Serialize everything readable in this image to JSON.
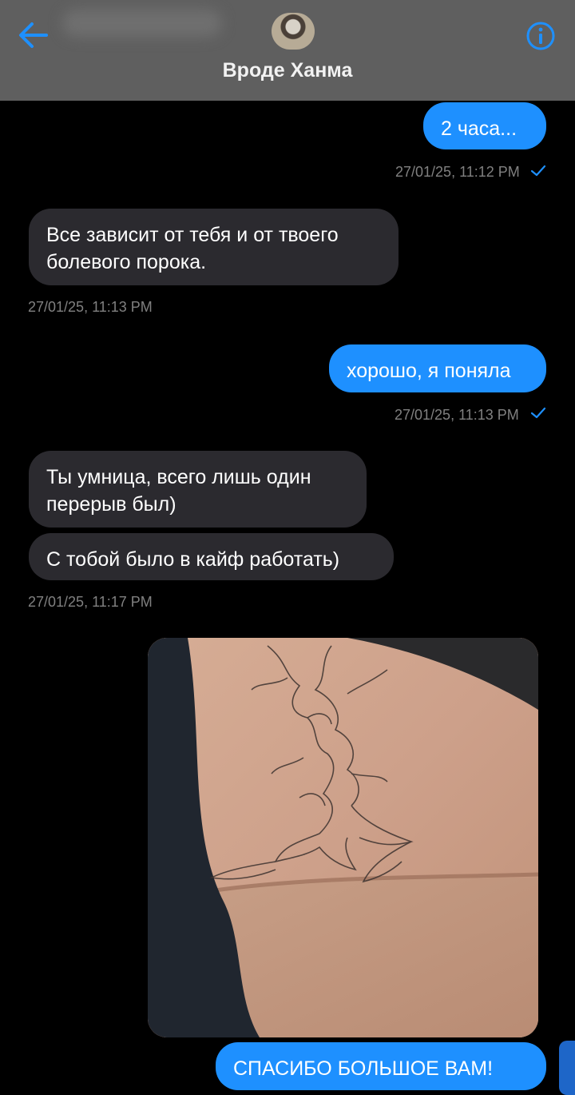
{
  "header": {
    "contact_name": "Вроде Ханма"
  },
  "icons": {
    "back": "arrow-left-icon",
    "info": "info-circle-icon"
  },
  "colors": {
    "header_bg": "#5f5f5f",
    "outgoing_bubble": "#1e90ff",
    "incoming_bubble": "#2b2a2f",
    "accent": "#1e90ff",
    "timestamp": "#808080"
  },
  "messages": [
    {
      "dir": "out",
      "text": "2 часа..."
    },
    {
      "dir": "out_time",
      "text": "27/01/25, 11:12 PM",
      "read": true
    },
    {
      "dir": "in",
      "text": "Все зависит от тебя и от твоего болевого порока."
    },
    {
      "dir": "in_time",
      "text": "27/01/25, 11:13 PM"
    },
    {
      "dir": "out",
      "text": "хорошо, я поняла"
    },
    {
      "dir": "out_time",
      "text": "27/01/25, 11:13 PM",
      "read": true
    },
    {
      "dir": "in",
      "text": "Ты умница, всего лишь один перерыв был)"
    },
    {
      "dir": "in",
      "text": "С тобой было в кайф работать)"
    },
    {
      "dir": "in_time",
      "text": "27/01/25, 11:17 PM"
    },
    {
      "dir": "out_image",
      "text": ""
    },
    {
      "dir": "out",
      "text": "СПАСИБО БОЛЬШОЕ ВАМ!"
    }
  ]
}
